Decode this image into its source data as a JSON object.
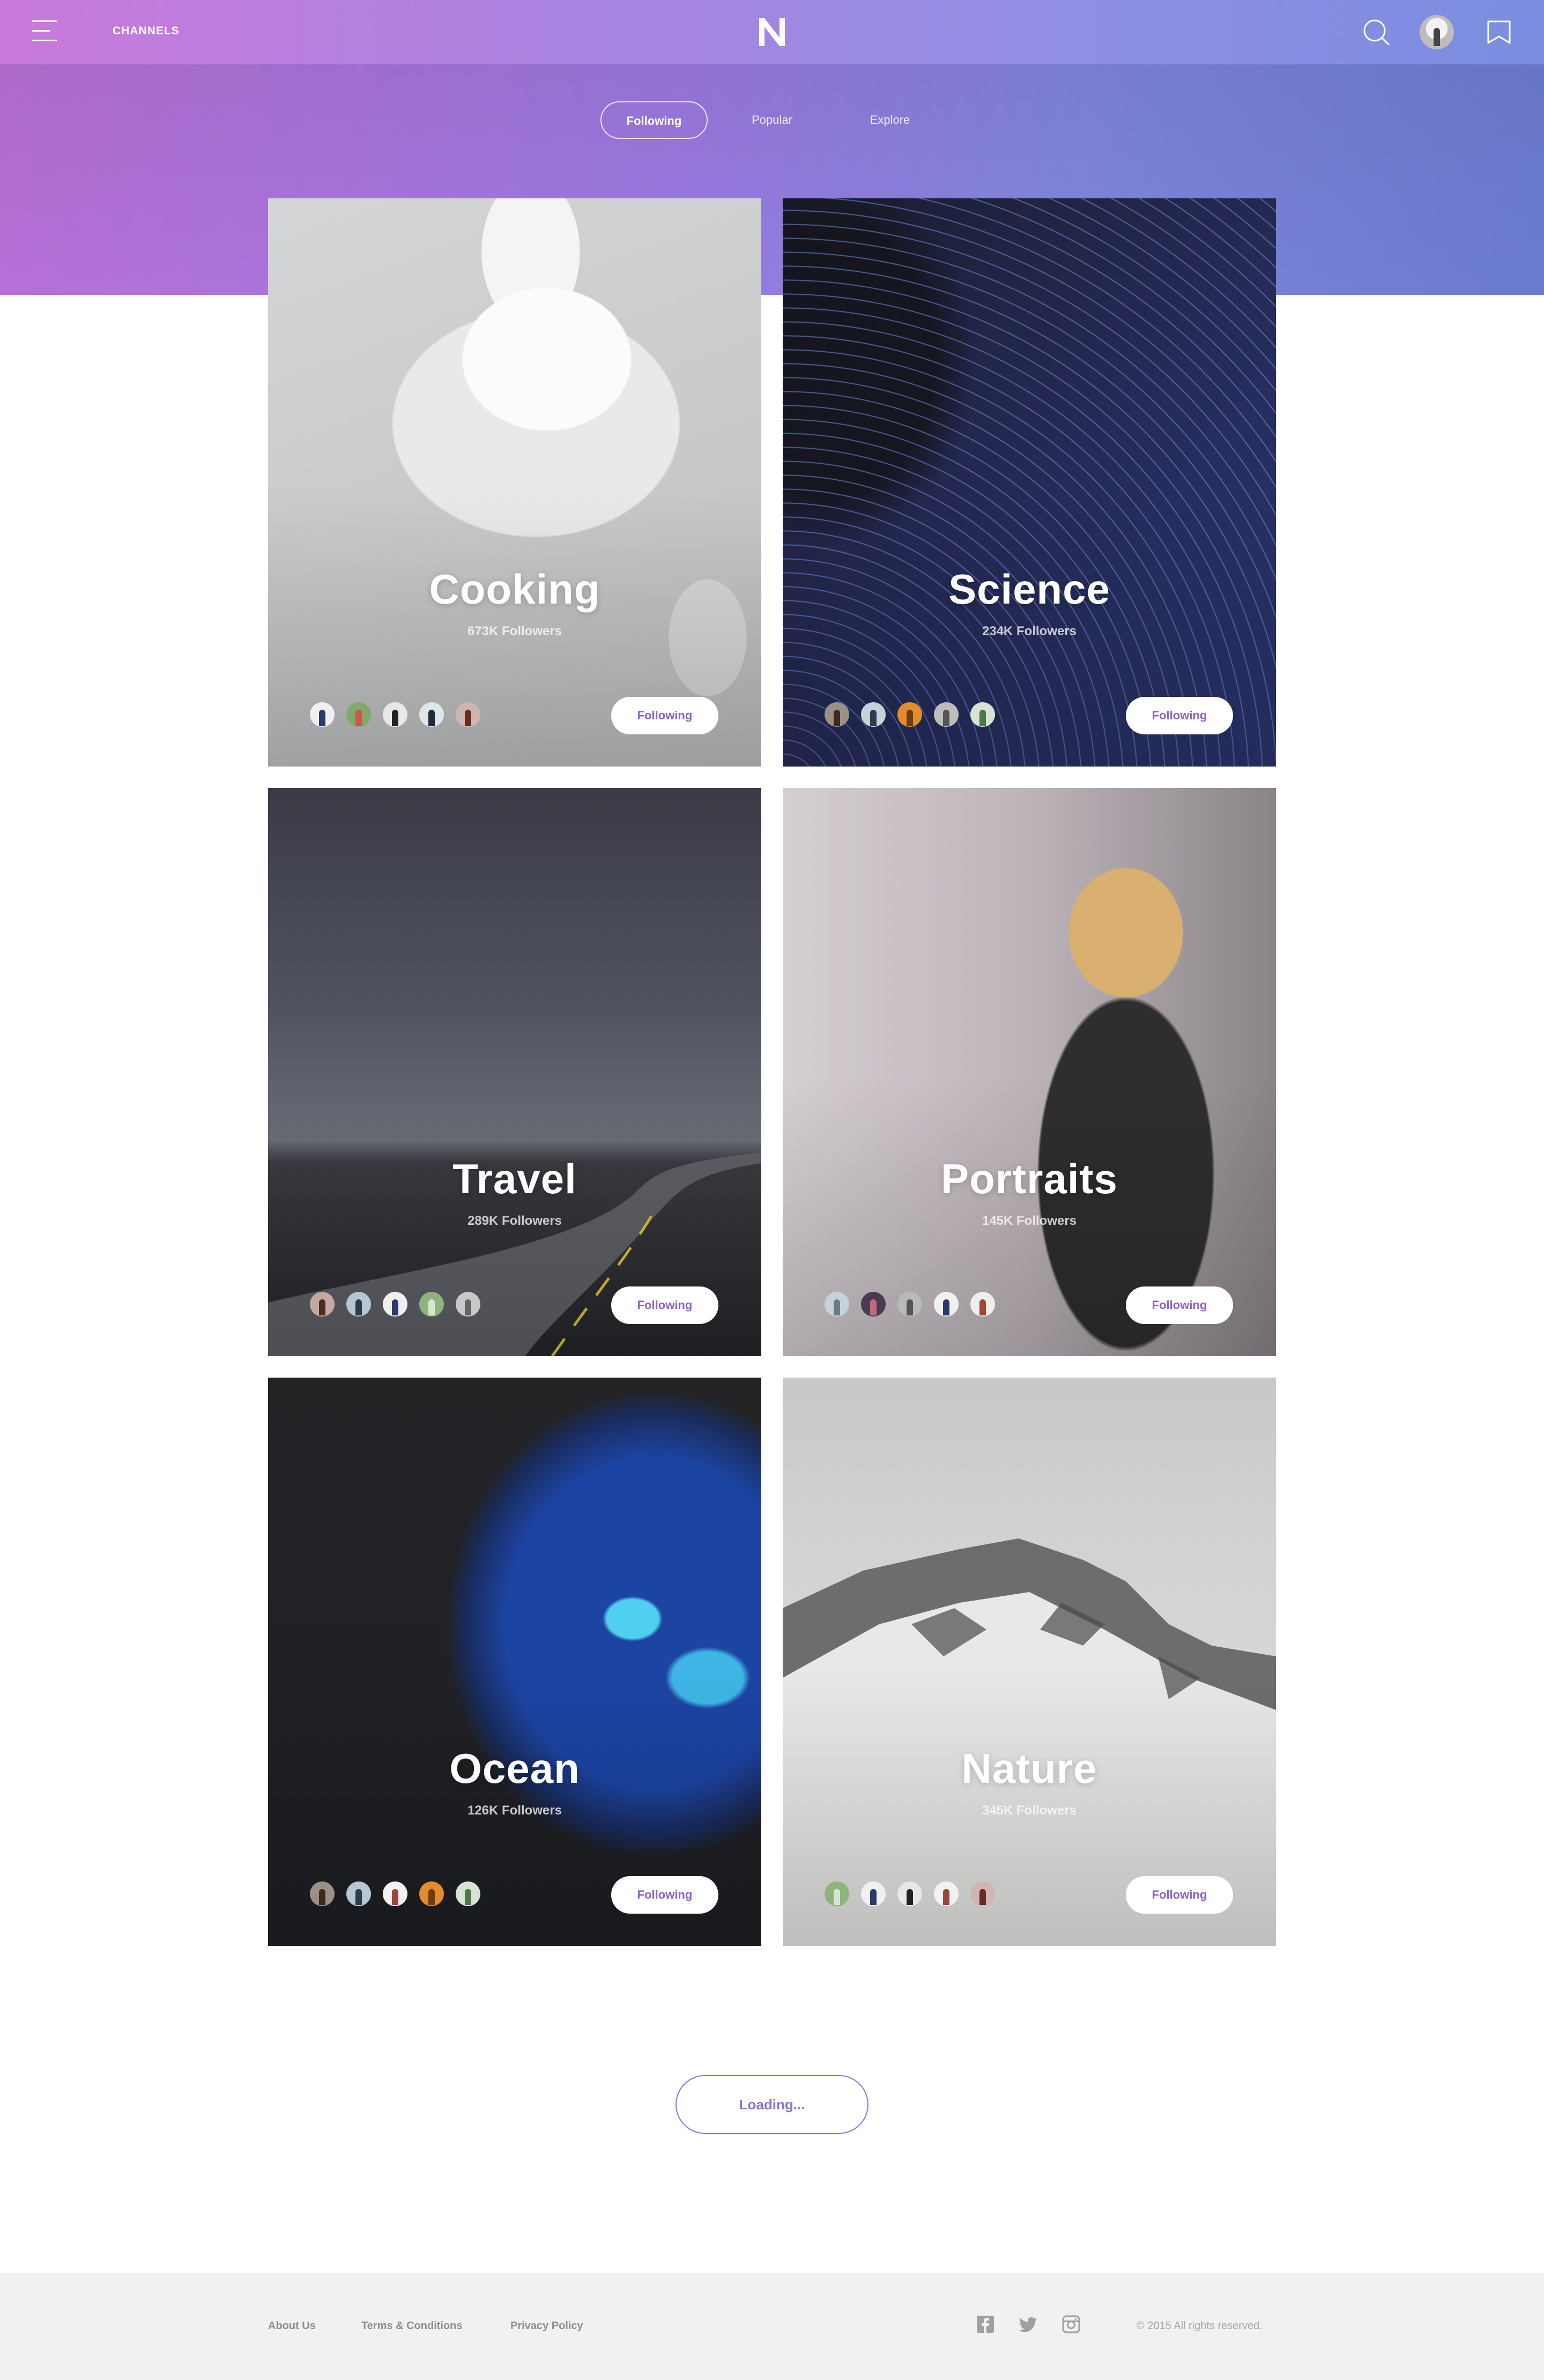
{
  "header": {
    "channels_label": "CHANNELS",
    "logo_letter": "N",
    "icons": [
      "menu-icon",
      "search-icon",
      "avatar",
      "bookmark-icon"
    ]
  },
  "tabs": [
    {
      "label": "Following",
      "active": true
    },
    {
      "label": "Popular",
      "active": false
    },
    {
      "label": "Explore",
      "active": false
    }
  ],
  "cards": [
    {
      "title": "Cooking",
      "followers": "673K Followers",
      "button": "Following"
    },
    {
      "title": "Science",
      "followers": "234K Followers",
      "button": "Following"
    },
    {
      "title": "Travel",
      "followers": "289K Followers",
      "button": "Following"
    },
    {
      "title": "Portraits",
      "followers": "145K Followers",
      "button": "Following"
    },
    {
      "title": "Ocean",
      "followers": "126K Followers",
      "button": "Following"
    },
    {
      "title": "Nature",
      "followers": "345K Followers",
      "button": "Following"
    }
  ],
  "loading_label": "Loading...",
  "footer": {
    "links": [
      "About Us",
      "Terms & Conditions",
      "Privacy Policy"
    ],
    "social_icons": [
      "facebook-icon",
      "twitter-icon",
      "instagram-icon"
    ],
    "copyright": "© 2015 All rights reserved."
  },
  "colors": {
    "accent": "#8c72d6",
    "hero_start": "#c879dc",
    "hero_end": "#6a7bd0",
    "footer_bg": "#f1f1f1"
  }
}
